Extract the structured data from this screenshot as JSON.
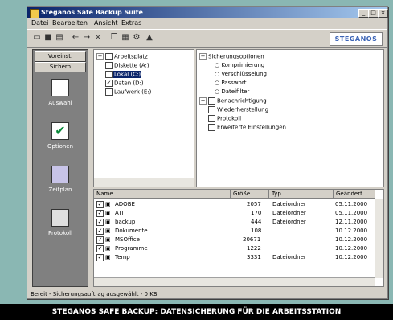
{
  "window": {
    "title": "Steganos Safe Backup Suite"
  },
  "menu": [
    "Datei",
    "Bearbeiten",
    "Ansicht",
    "Extras"
  ],
  "toolbar": {
    "brand": "STEGANOS"
  },
  "sidebar": {
    "tabs": [
      "Voreinst.",
      "Sichern"
    ],
    "items": [
      {
        "label": "Auswahl",
        "icon": "folder-icon"
      },
      {
        "label": "Optionen",
        "icon": "check-icon"
      },
      {
        "label": "Zeitplan",
        "icon": "calendar-icon"
      },
      {
        "label": "Protokoll",
        "icon": "log-icon"
      }
    ]
  },
  "tree": [
    "Arbeitsplatz",
    "Diskette (A:)",
    "Lokal (C:)",
    "Daten (D:)",
    "Laufwerk (E:)"
  ],
  "options": [
    "Sicherungsoptionen",
    "Komprimierung",
    "Verschlüsselung",
    "Passwort",
    "Dateifilter",
    "Benachrichtigung",
    "Wiederherstellung",
    "Protokoll",
    "Erweiterte Einstellungen"
  ],
  "list": {
    "columns": [
      "Name",
      "Größe",
      "Typ",
      "Geändert"
    ],
    "rows": [
      {
        "name": "ADOBE",
        "size": "2057",
        "type": "Dateiordner",
        "date": "05.11.2000"
      },
      {
        "name": "ATI",
        "size": "170",
        "type": "Dateiordner",
        "date": "05.11.2000"
      },
      {
        "name": "backup",
        "size": "444",
        "type": "Dateiordner",
        "date": "12.11.2000"
      },
      {
        "name": "Dokumente",
        "size": "108",
        "type": "",
        "date": "10.12.2000"
      },
      {
        "name": "MSOffice",
        "size": "20671",
        "type": "",
        "date": "10.12.2000"
      },
      {
        "name": "Programme",
        "size": "1222",
        "type": "",
        "date": "10.12.2000"
      },
      {
        "name": "Temp",
        "size": "3331",
        "type": "Dateiordner",
        "date": "10.12.2000"
      }
    ]
  },
  "status": "Bereit - Sicherungsauftrag ausgewählt - 0 KB",
  "caption": "STEGANOS SAFE BACKUP: DATENSICHERUNG FÜR DIE ARBEITSSTATION"
}
